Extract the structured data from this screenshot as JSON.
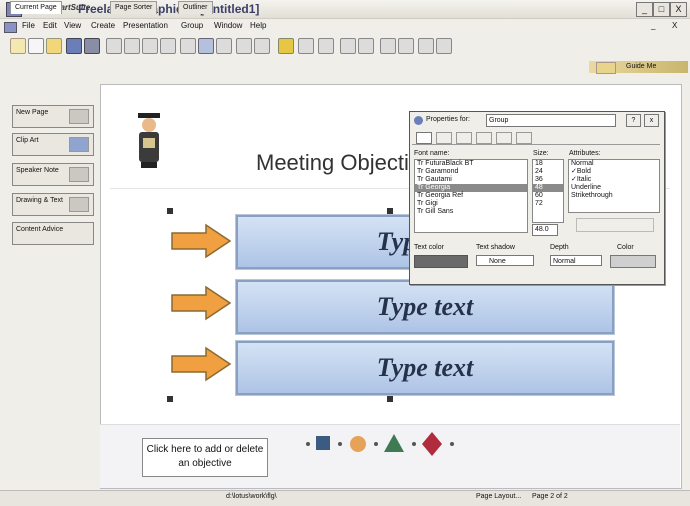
{
  "window": {
    "brand": "Lotus SmartSuite",
    "title": "Freelance Graphics - [Untitled1]",
    "minimize": "_",
    "maximize": "□",
    "close": "X"
  },
  "menu": [
    "File",
    "Edit",
    "View",
    "Create",
    "Presentation",
    "Group",
    "Window",
    "Help"
  ],
  "tabs": {
    "current": "Current Page",
    "sorter": "Page Sorter",
    "outliner": "Outliner",
    "guide": "Guide Me"
  },
  "left_panel": {
    "new_page": "New Page",
    "clip_art": "Clip Art",
    "speaker_note": "Speaker Note",
    "drawing_text": "Drawing & Text",
    "content_advice": "Content Advice"
  },
  "slide": {
    "title": "Meeting Objectives",
    "boxes": [
      "Type text",
      "Type text",
      "Type text"
    ],
    "click_here": "Click here to add or delete an objective"
  },
  "properties": {
    "label": "Properties for:",
    "target": "Group",
    "help": "?",
    "close": "x",
    "font_name_label": "Font name:",
    "size_label": "Size:",
    "attributes_label": "Attributes:",
    "fonts": [
      "Tr FuturaBlack BT",
      "Tr Garamond",
      "Tr Gautami",
      "Tr Georgia",
      "Tr Georgia Ref",
      "Tr Gigi",
      "Tr Gill Sans"
    ],
    "sizes": [
      "18",
      "24",
      "36",
      "48",
      "60",
      "72"
    ],
    "size_value": "48.0",
    "attributes": [
      "Normal",
      "✓Bold",
      "✓Italic",
      "Underline",
      "Strikethrough"
    ],
    "text_color_label": "Text color",
    "text_shadow_label": "Text shadow",
    "shadow_value": "None",
    "depth_label": "Depth",
    "depth_value": "Normal",
    "color_label": "Color"
  },
  "status": {
    "path": "d:\\lotus\\work\\flg\\",
    "layout": "Page Layout...",
    "page": "Page 2 of 2"
  },
  "colors": {
    "text_box_fill": "#b9cdec",
    "arrow_fill": "#f0a040"
  }
}
